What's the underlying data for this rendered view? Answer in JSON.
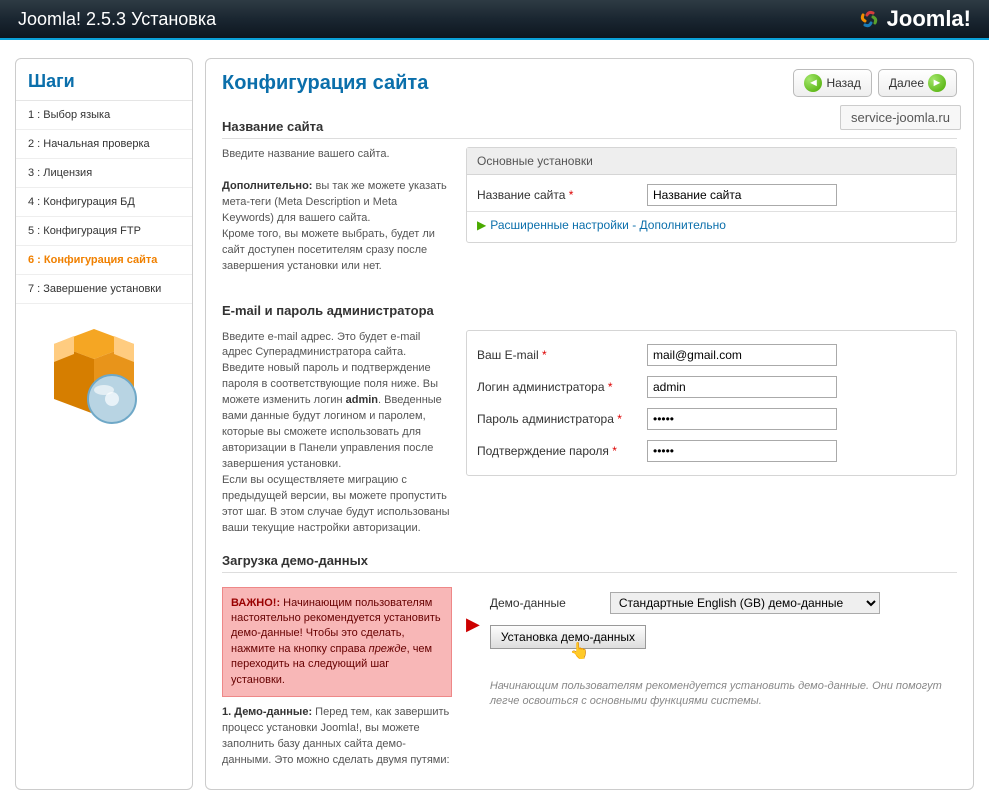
{
  "topbar": {
    "title": "Joomla! 2.5.3 Установка",
    "logo_text": "Joomla!"
  },
  "sidebar": {
    "heading": "Шаги",
    "steps": [
      "1 : Выбор языка",
      "2 : Начальная проверка",
      "3 : Лицензия",
      "4 : Конфигурация БД",
      "5 : Конфигурация FTP",
      "6 : Конфигурация сайта",
      "7 : Завершение установки"
    ]
  },
  "main": {
    "title": "Конфигурация сайта",
    "back_label": "Назад",
    "next_label": "Далее",
    "watermark": "service-joomla.ru"
  },
  "s1": {
    "title": "Название сайта",
    "intro": "Введите название вашего сайта.",
    "extra_bold": "Дополнительно:",
    "extra_text": " вы так же можете указать мета-теги (Meta Description и Meta Keywords) для вашего сайта.",
    "extra_text2": "Кроме того, вы можете выбрать, будет ли сайт доступен посетителям сразу после завершения установки или нет.",
    "box_head": "Основные установки",
    "site_label": "Название сайта",
    "site_value": "Название сайта",
    "expand": "Расширенные настройки - Дополнительно"
  },
  "s2": {
    "title": "E-mail и пароль администратора",
    "p1": "Введите e-mail адрес. Это будет e-mail адрес Суперадминистратора сайта.",
    "p2_a": "Введите новый пароль и подтверждение пароля в соответствующие поля ниже. Вы можете изменить логин ",
    "p2_b": "admin",
    "p2_c": ". Введенные вами данные будут логином и паролем, которые вы сможете использовать для авторизации в Панели управления после завершения установки.",
    "p3": "Если вы осуществляете миграцию с предыдущей версии, вы можете пропустить этот шаг. В этом случае будут использованы ваши текущие настройки авторизации.",
    "email_label": "Ваш E-mail",
    "email_value": "mail@gmail.com",
    "login_label": "Логин администратора",
    "login_value": "admin",
    "pass_label": "Пароль администратора",
    "pass_value": "•••••",
    "pass2_label": "Подтверждение пароля",
    "pass2_value": "•••••"
  },
  "s3": {
    "title": "Загрузка демо-данных",
    "warn_bold": "ВАЖНО!:",
    "warn_text_a": " Начинающим пользователям настоятельно рекомендуется установить демо-данные! Чтобы это сделать, нажмите на кнопку справа ",
    "warn_text_i": "прежде",
    "warn_text_b": ", чем переходить на следующий шаг установки.",
    "note_bold": "1. Демо-данные:",
    "note_text": " Перед тем, как завершить процесс установки Joomla!, вы можете заполнить базу данных сайта демо-данными. Это можно сделать двумя путями:",
    "demo_label": "Демо-данные",
    "demo_option": "Стандартные English (GB) демо-данные",
    "demo_btn": "Установка демо-данных",
    "demo_note": "Начинающим пользователям рекомендуется установить демо-данные. Они помогут легче освоиться с основными функциями системы."
  }
}
